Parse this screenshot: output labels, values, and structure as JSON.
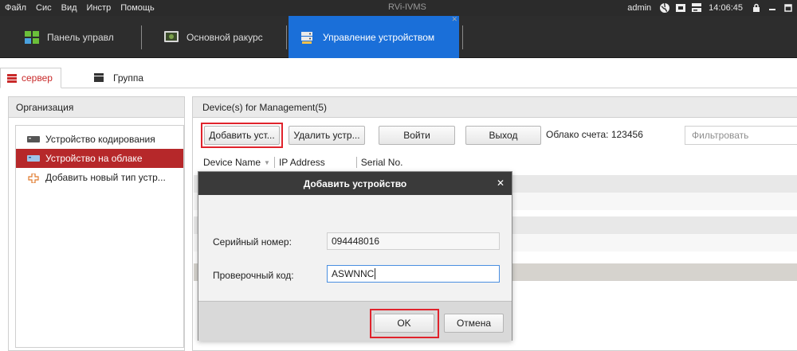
{
  "menubar": {
    "items": [
      "Файл",
      "Сис",
      "Вид",
      "Инстр",
      "Помощь"
    ],
    "app_title": "RVi-IVMS",
    "user": "admin",
    "time": "14:06:45"
  },
  "toolbar": {
    "tabs": [
      {
        "label": "Панель управл",
        "icon": "control-panel-icon"
      },
      {
        "label": "Основной ракурс",
        "icon": "main-view-icon"
      },
      {
        "label": "Управление устройством",
        "icon": "device-management-icon",
        "active": true
      }
    ],
    "active_color": "#1a6fd9"
  },
  "subtabs": [
    {
      "label": "сервер",
      "active": true
    },
    {
      "label": "Группа",
      "active": false
    }
  ],
  "left_panel": {
    "header": "Организация",
    "items": [
      {
        "label": "Устройство кодирования",
        "icon": "encoding-device-icon"
      },
      {
        "label": "Устройство на облаке",
        "icon": "cloud-device-icon",
        "selected": true
      },
      {
        "label": "Добавить новый тип устр...",
        "icon": "add-device-type-icon"
      }
    ],
    "selected_color": "#b6282a"
  },
  "right_panel": {
    "header": "Device(s) for Management(5)",
    "buttons": {
      "add": "Добавить уст...",
      "delete": "Удалить устр...",
      "login": "Войти",
      "logout": "Выход"
    },
    "cloud_account": "Облако счета: 123456",
    "filter_placeholder": "Фильтровать",
    "columns": [
      "Device Name",
      "IP Address",
      "Serial No."
    ]
  },
  "dialog": {
    "title": "Добавить устройство",
    "serial_label": "Серийный номер:",
    "serial_value": "094448016",
    "verify_label": "Проверочный код:",
    "verify_value": "ASWNNC",
    "ok": "OK",
    "cancel": "Отмена"
  },
  "highlight_color": "#e0232c"
}
